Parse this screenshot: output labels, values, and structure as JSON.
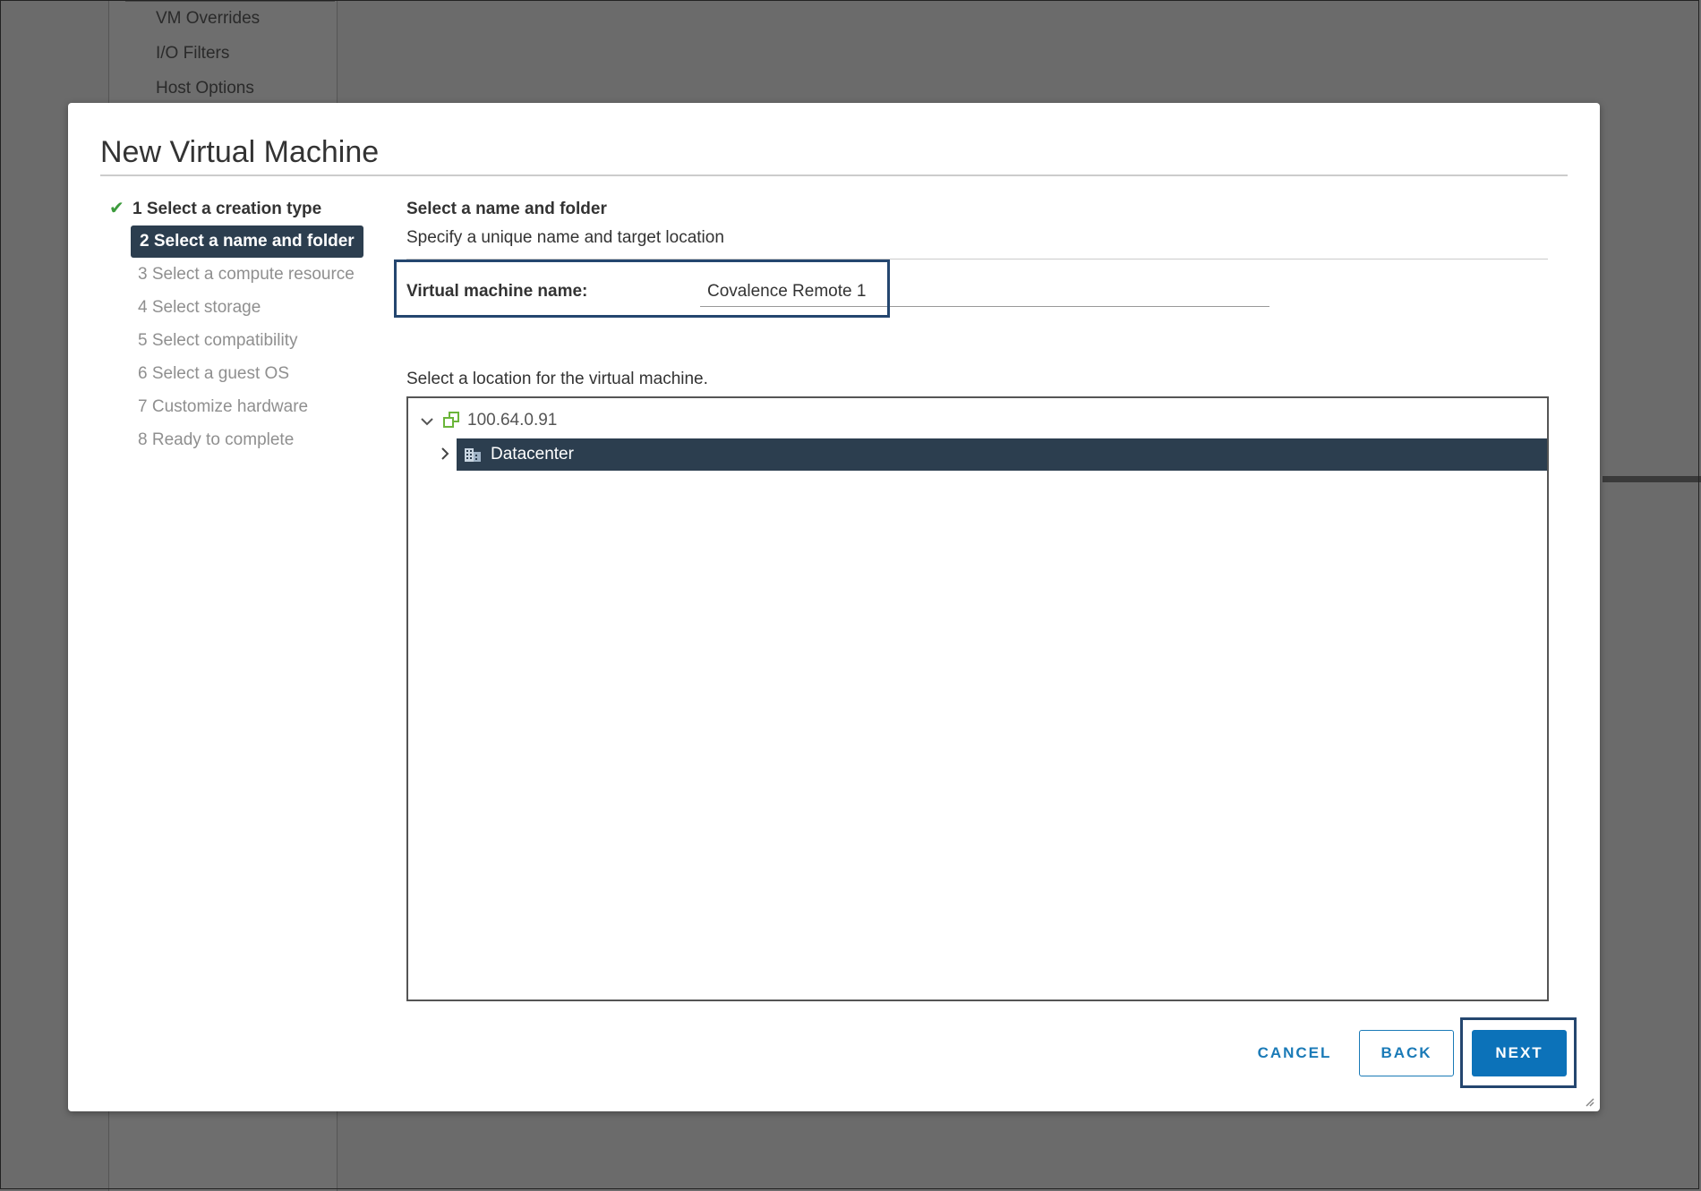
{
  "background": {
    "nav_items": [
      "VM Overrides",
      "I/O Filters",
      "Host Options"
    ]
  },
  "dialog": {
    "title": "New Virtual Machine",
    "steps": [
      {
        "label": "1 Select a creation type",
        "state": "done"
      },
      {
        "label": "2 Select a name and folder",
        "state": "active"
      },
      {
        "label": "3 Select a compute resource",
        "state": "todo"
      },
      {
        "label": "4 Select storage",
        "state": "todo"
      },
      {
        "label": "5 Select compatibility",
        "state": "todo"
      },
      {
        "label": "6 Select a guest OS",
        "state": "todo"
      },
      {
        "label": "7 Customize hardware",
        "state": "todo"
      },
      {
        "label": "8 Ready to complete",
        "state": "todo"
      }
    ],
    "section": {
      "title": "Select a name and folder",
      "subtitle": "Specify a unique name and target location"
    },
    "vm_name": {
      "label": "Virtual machine name:",
      "value": "Covalence Remote 1"
    },
    "location": {
      "label": "Select a location for the virtual machine.",
      "tree": {
        "root": {
          "label": "100.64.0.91",
          "icon": "vcenter-icon",
          "expanded": true
        },
        "child": {
          "label": "Datacenter",
          "icon": "datacenter-icon",
          "selected": true
        }
      }
    },
    "buttons": {
      "cancel": "CANCEL",
      "back": "BACK",
      "next": "NEXT"
    }
  },
  "colors": {
    "selected_bg": "#2c3e4f",
    "primary_button": "#0c72b9",
    "link_blue": "#1a7ab7",
    "check_green": "#3c9b3c",
    "annotation_box": "#24466f"
  }
}
